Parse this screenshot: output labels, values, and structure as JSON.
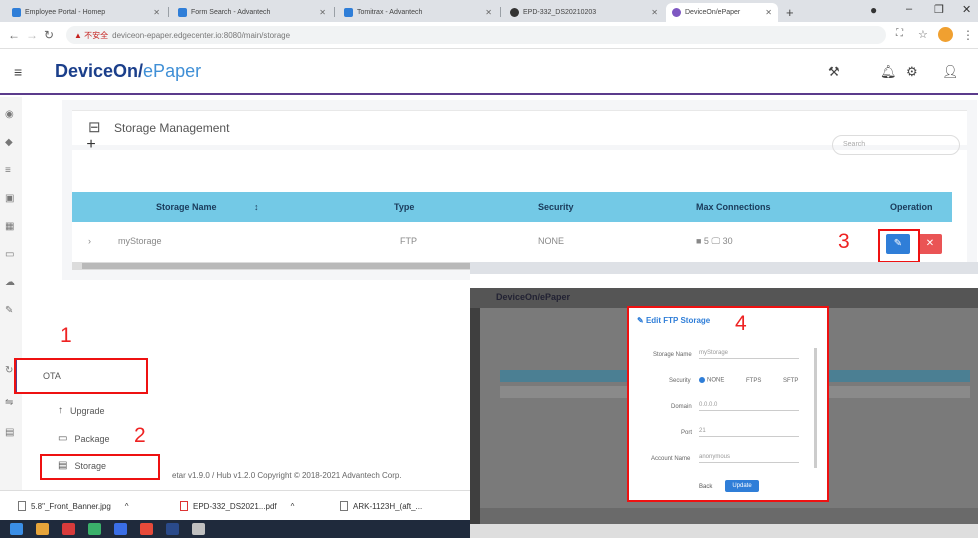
{
  "browser": {
    "tabs": [
      {
        "label": "Employee Portal - Homep",
        "color": "#2f7ed8"
      },
      {
        "label": "Form Search - Advantech",
        "color": "#2f7ed8"
      },
      {
        "label": "Tomitrax - Advantech",
        "color": "#2f7ed8"
      },
      {
        "label": "EPD-332_DS20210203",
        "color": "#333333"
      },
      {
        "label": "DeviceOn/ePaper",
        "color": "#7e57c2",
        "active": true
      }
    ],
    "new_tab": "+",
    "url_warning": "▲ 不安全",
    "url": "deviceon-epaper.edgecenter.io:8080/main/storage"
  },
  "app": {
    "logo_main": "DeviceOn/",
    "logo_accent": "ePaper",
    "title": "Storage Management",
    "add": "+",
    "search_placeholder": "Search"
  },
  "menu": {
    "ota": "OTA",
    "upgrade": "Upgrade",
    "package": "Package",
    "storage": "Storage"
  },
  "table": {
    "headers": [
      "Storage Name",
      "Type",
      "Security",
      "Max Connections",
      "Operation"
    ],
    "row": {
      "name": "myStorage",
      "type": "FTP",
      "security": "NONE",
      "max_connections": "■ 5  🖵 30"
    }
  },
  "annotations": [
    "1",
    "2",
    "3",
    "4"
  ],
  "footer": {
    "copyright": "etar v1.9.0 / Hub v1.2.0 Copyright © 2018-2021 Advantech Corp."
  },
  "downloads": [
    "5.8\"_Front_Banner.jpg",
    "EPD-332_DS2021...pdf",
    "ARK-1123H_(aft_..."
  ],
  "dialog": {
    "title": "Edit FTP Storage",
    "fields": [
      {
        "label": "Storage Name",
        "value": "myStorage"
      },
      {
        "label": "Security",
        "value": ""
      },
      {
        "label": "Domain",
        "value": "0.0.0.0"
      },
      {
        "label": "Port",
        "value": "21"
      },
      {
        "label": "Account Name",
        "value": "anonymous"
      }
    ],
    "security_options": [
      "NONE",
      "FTPS",
      "SFTP"
    ],
    "cancel": "Back",
    "save": "Update"
  },
  "colors": {
    "header_underline": "#5b3b8c",
    "table_header": "#73c9e6",
    "edit_button": "#2f7ed8",
    "delete_button": "#ea5455",
    "highlight": "#e11111"
  }
}
